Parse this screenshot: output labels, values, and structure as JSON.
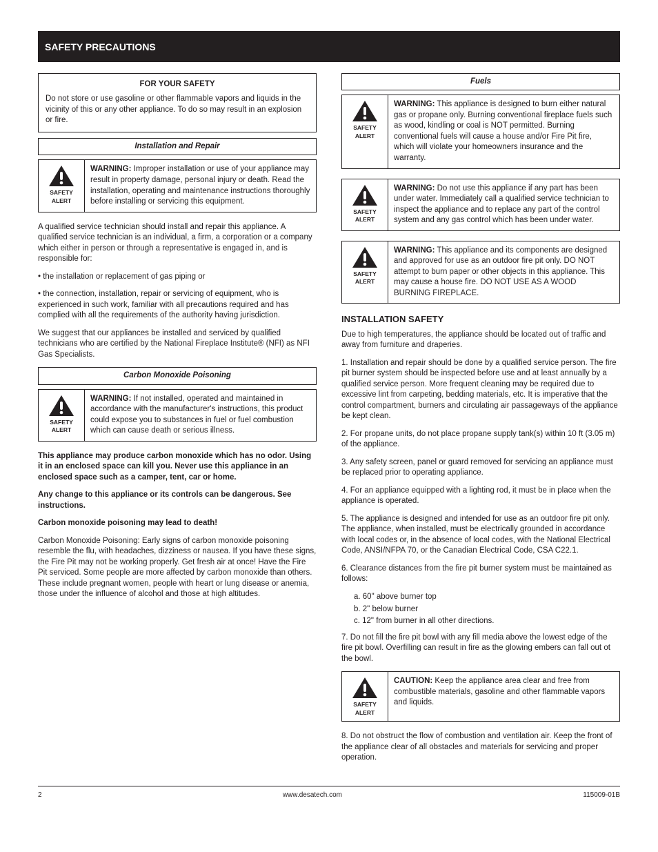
{
  "banner": "SAFETY  PRECAUTIONS",
  "leftCol": {
    "forYourSafety": {
      "title": "FOR YOUR SAFETY",
      "body": "Do not store or use gasoline or other flammable vapors and liquids in the vicinity of this or any other appliance. To do so may result in an explosion or fire."
    },
    "installationHeader": "Installation and Repair",
    "warn1": {
      "level": "WARNING:",
      "text": "Improper installation or use of your appliance may result in property damage, personal injury or death. Read the installation, operating and maintenance instructions thoroughly before installing or servicing this equipment."
    },
    "installParas": [
      "A qualified service technician should install and repair this appliance. A qualified service technician is an individual, a firm, a corporation or a company which either in person or through a representative is engaged in, and is responsible for:",
      "• the installation or replacement of gas piping or",
      "• the connection, installation, repair or servicing of equipment, who is experienced in such work, familiar with all precautions required and has complied with all the requirements of the authority having jurisdiction."
    ],
    "carbonIntro": "We suggest that our appliances be installed and serviced by qualified technicians who are certified by the National Fireplace Institute® (NFI) as NFI Gas Specialists.",
    "carbonHeader": "Carbon Monoxide Poisoning",
    "carbonWarn": {
      "level": "WARNING:",
      "text": "If not installed, operated and maintained in accordance with the manufacturer's instructions, this product could expose you to substances in fuel or fuel combustion which can cause death or serious illness."
    },
    "carbonParas": [
      "This appliance may produce carbon monoxide which has no odor. Using it in an enclosed space can kill you. Never use this appliance in an enclosed space such as a camper, tent, car or home.",
      "Any change to this appliance or its controls can be dangerous. See instructions.",
      "Carbon monoxide poisoning may lead to death!",
      "Carbon Monoxide Poisoning: Early signs of carbon monoxide poisoning resemble the flu, with headaches, dizziness or nausea. If you have these signs, the Fire Pit may not be working properly. Get fresh air at once! Have the Fire Pit serviced. Some people are more affected by carbon monoxide than others. These include pregnant women, people with heart or lung disease or anemia, those under the influence of alcohol and those at high altitudes."
    ]
  },
  "rightCol": {
    "fuelsHeader": "Fuels",
    "fuelsWarn1": {
      "level": "WARNING:",
      "text": "This appliance is designed to burn either natural gas or propane only. Burning conventional fireplace fuels such as wood, kindling or coal is NOT permitted. Burning conventional fuels will cause a house and/or Fire Pit fire, which will violate your homeowners insurance and the warranty."
    },
    "fuelsWarn2": {
      "level": "WARNING:",
      "text": "Do not use this appliance if any part has been under water. Immediately call a qualified service technician to inspect the appliance and to replace any part of the control system and any gas control which has been under water."
    },
    "fuelsWarn3": {
      "level": "WARNING:",
      "text": "This appliance and its components are designed and approved for use as an outdoor fire pit only. DO NOT attempt to burn paper or other objects in this appliance. This may cause a house fire. DO NOT USE AS A WOOD BURNING FIREPLACE."
    },
    "installSafetyHeader": "INSTALLATION SAFETY",
    "installIntro": "Due to high temperatures, the appliance should be located out of traffic and away from furniture and draperies.",
    "installWarnings": [
      "1. Installation and repair should be done by a qualified service person. The fire pit burner system should be inspected before use and at least annually by a qualified service person. More frequent cleaning may be required due to excessive lint from carpeting, bedding materials, etc. It is imperative that the control compartment, burners and circulating air passageways of the appliance be kept clean.",
      "2. For propane units, do not place propane supply tank(s) within 10 ft (3.05 m) of the appliance.",
      "3. Any safety screen, panel or guard removed for servicing an appliance must be replaced prior to operating appliance.",
      "4. For an appliance equipped with a lighting rod, it must be in place when the appliance is operated.",
      "5. The appliance is designed and intended for use as an outdoor fire pit only. The appliance, when installed, must be electrically grounded in accordance with local codes or, in the absence of local codes, with the National Electrical Code, ANSI/NFPA 70, or the Canadian Electrical Code, CSA C22.1.",
      "6. Clearance distances from the fire pit burner system must be maintained as follows:"
    ],
    "clearanceList": [
      "a. 60\" above burner top",
      "b. 2\" below burner",
      "c. 12\" from burner in all other directions."
    ],
    "fillPara": "7. Do not fill the fire pit bowl with any fill media above the lowest edge of the fire pit bowl. Overfilling can result in fire as the glowing embers can fall out ot the bowl.",
    "keepClearWarn": {
      "level": "CAUTION:",
      "text": "Keep the appliance area clear and free from combustible materials, gasoline and other flammable vapors and liquids."
    },
    "airPara": "8. Do not obstruct the flow of combustion and ventilation air. Keep the front of the appliance clear of all obstacles and materials for servicing and proper operation."
  },
  "footer": {
    "left": "2",
    "right": "www.desatech.com",
    "rev": "115009-01B"
  }
}
